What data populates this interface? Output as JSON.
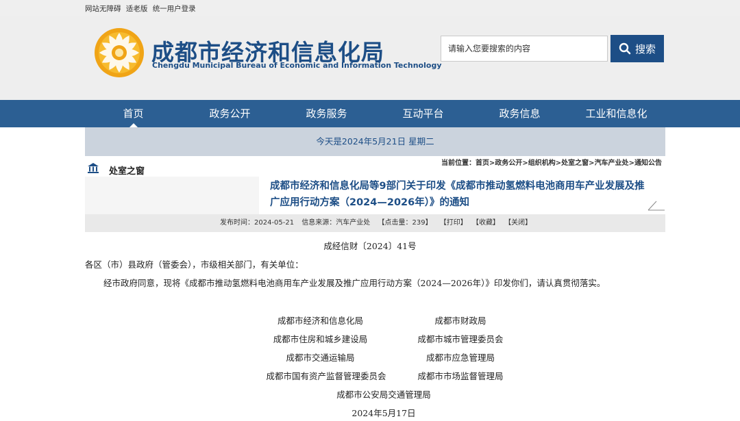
{
  "top_links": [
    "网站无障碍",
    "适老版",
    "统一用户登录"
  ],
  "site": {
    "title_cn": "成都市经济和信息化局",
    "title_en": "Chengdu Municipal Bureau of Economic and Information Technology"
  },
  "search": {
    "placeholder": "请输入您要搜索的内容",
    "button_label": "搜索"
  },
  "nav": {
    "items": [
      "首页",
      "政务公开",
      "政务服务",
      "互动平台",
      "政务信息",
      "工业和信息化"
    ],
    "active": 0
  },
  "date_text": "今天是2024年5月21日 星期二",
  "section": {
    "title": "处室之窗"
  },
  "breadcrumb": {
    "prefix": "当前位置：",
    "items": [
      "首页",
      "政务公开",
      "组织机构",
      "处室之窗",
      "汽车产业处",
      "通知公告"
    ],
    "separator": ">"
  },
  "article": {
    "title": "成都市经济和信息化局等9部门关于印发《成都市推动氢燃料电池商用车产业发展及推广应用行动方案（2024—2026年）》的通知",
    "meta": {
      "publish_time": "发布时间：2024-05-21",
      "source": "信息来源：汽车产业处",
      "clicks": "【点击量：239】",
      "print": "【打印】",
      "favorite": "【收藏】",
      "close": "【关闭】"
    },
    "doc_number": "成经信财〔2024〕41号",
    "salutation": "各区（市）县政府（管委会），市级相关部门，有关单位：",
    "body": "经市政府同意，现将《成都市推动氢燃料电池商用车产业发展及推广应用行动方案（2024—2026年）》印发你们，请认真贯彻落实。",
    "signatories": [
      [
        "成都市经济和信息化局",
        "成都市财政局"
      ],
      [
        "成都市住房和城乡建设局",
        "成都市城市管理委员会"
      ],
      [
        "成都市交通运输局",
        "成都市应急管理局"
      ],
      [
        "成都市国有资产监督管理委员会",
        "成都市市场监督管理局"
      ]
    ],
    "last_signatory": "成都市公安局交通管理局",
    "date": "2024年5月17日"
  },
  "colors": {
    "brand": "#1d4e86",
    "nav_bg": "#2c5f93",
    "date_bar": "#cbd3dd",
    "logo_gold": "#f0a416"
  }
}
